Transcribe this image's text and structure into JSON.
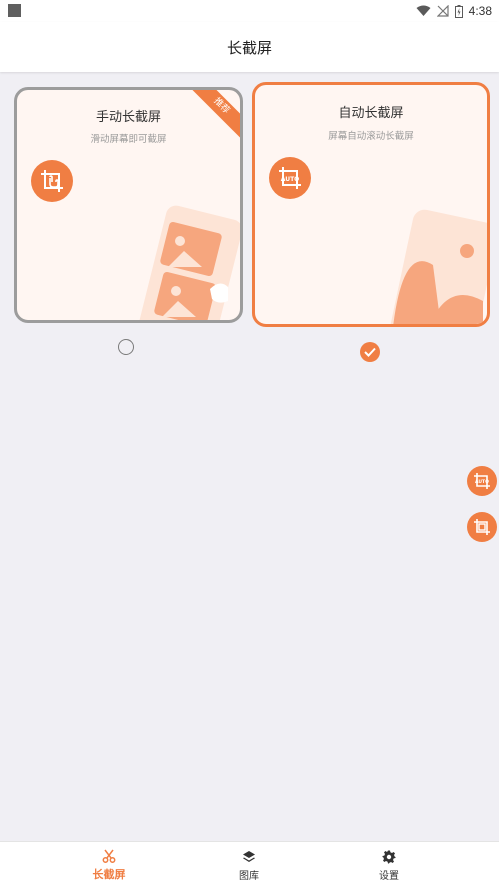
{
  "status_bar": {
    "time": "4:38"
  },
  "app_bar": {
    "title": "长截屏"
  },
  "cards": [
    {
      "id": "manual",
      "title": "手动长截屏",
      "subtitle": "滑动屏幕即可截屏",
      "badge": "推荐",
      "icon": "hand-crop-icon",
      "selected": false
    },
    {
      "id": "auto",
      "title": "自动长截屏",
      "subtitle": "屏幕自动滚动长截屏",
      "icon": "auto-crop-icon",
      "selected": true
    }
  ],
  "floating_buttons": [
    {
      "icon": "auto-screenshot-icon",
      "badge_text": "AUTO"
    },
    {
      "icon": "crop-screenshot-icon"
    }
  ],
  "bottom_nav": {
    "items": [
      {
        "label": "长截屏",
        "icon": "scissors-icon",
        "active": true
      },
      {
        "label": "图库",
        "icon": "layers-icon",
        "active": false
      },
      {
        "label": "设置",
        "icon": "gear-icon",
        "active": false
      }
    ]
  },
  "colors": {
    "accent": "#f07e43",
    "background": "#f0eff4",
    "card_bg": "#fff6f2"
  }
}
